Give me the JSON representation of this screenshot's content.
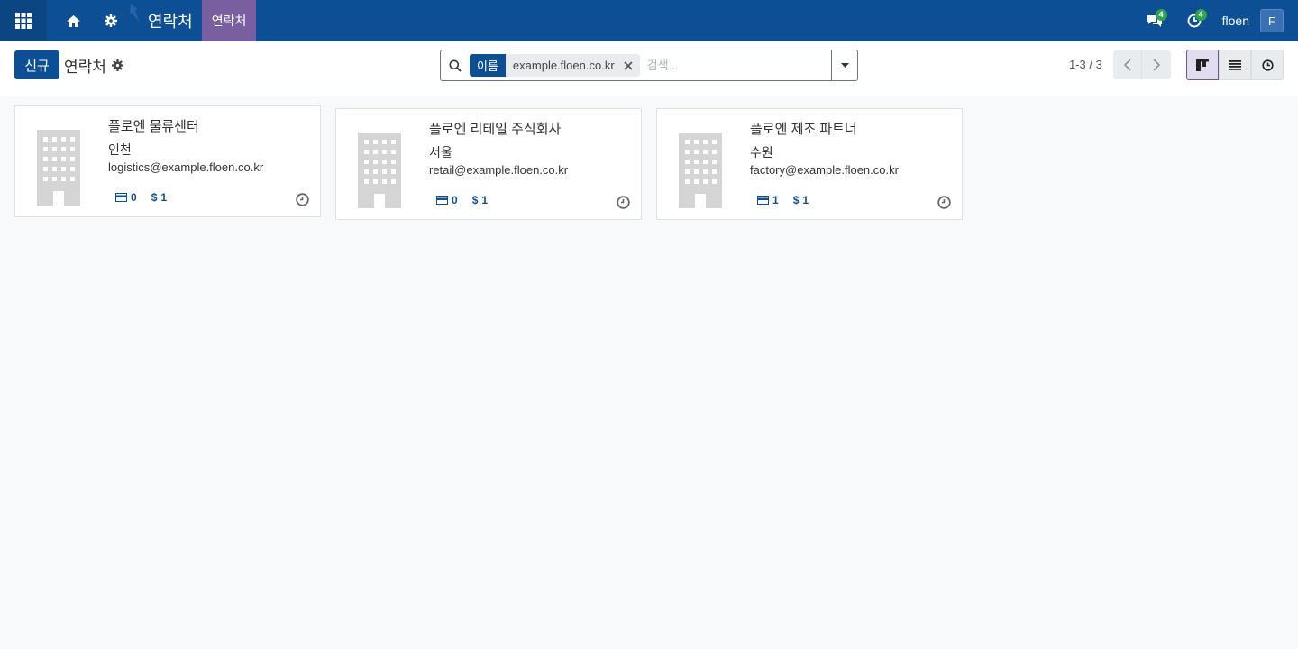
{
  "navbar": {
    "brand": "연락처",
    "menu_item": "연락처",
    "messages_count": "4",
    "activities_count": "4",
    "user_name": "floen",
    "user_initial": "F",
    "colors": {
      "bar": "#0d4f94",
      "menu_active": "#7a5fa0",
      "badge": "#2ea44f"
    }
  },
  "control_panel": {
    "new_button": "신규",
    "title": "연락처",
    "search": {
      "facet_label": "이름",
      "facet_value": "example.floen.co.kr",
      "placeholder": "검색..."
    },
    "pager": "1-3 / 3",
    "views": [
      "kanban",
      "list",
      "activity"
    ],
    "active_view": "kanban"
  },
  "cards": [
    {
      "name": "플로엔 물류센터",
      "city": "인천",
      "email": "logistics@example.floen.co.kr",
      "cards_count": "0",
      "sales_count": "1"
    },
    {
      "name": "플로엔 리테일 주식회사",
      "city": "서울",
      "email": "retail@example.floen.co.kr",
      "cards_count": "0",
      "sales_count": "1"
    },
    {
      "name": "플로엔 제조 파트너",
      "city": "수원",
      "email": "factory@example.floen.co.kr",
      "cards_count": "1",
      "sales_count": "1"
    }
  ]
}
